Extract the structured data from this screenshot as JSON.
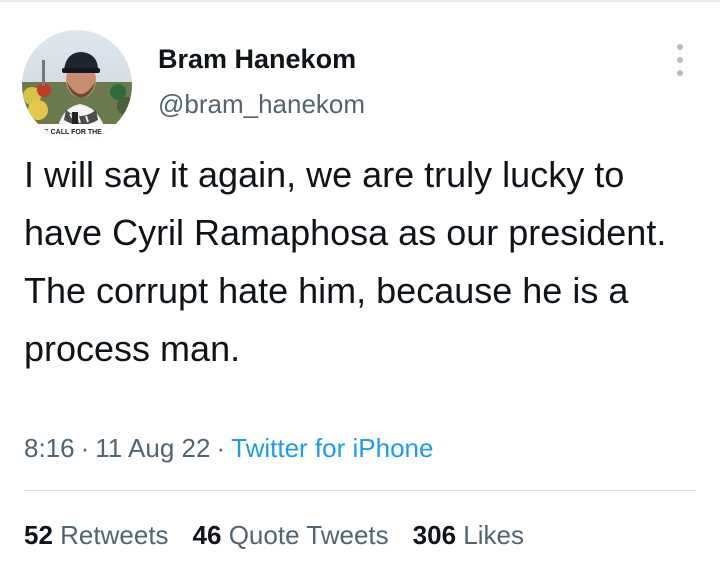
{
  "user": {
    "display_name": "Bram Hanekom",
    "handle": "@bram_hanekom",
    "avatar_caption": "S CALL FOR THE"
  },
  "tweet": {
    "text": "I will say it again, we are truly lucky to have Cyril Ramaphosa as our president. The corrupt hate him, because he is a process man."
  },
  "meta": {
    "time": "8:16",
    "separator": "·",
    "date": "11 Aug 22",
    "source": "Twitter for iPhone"
  },
  "stats": {
    "retweets_count": "52",
    "retweets_label": "Retweets",
    "quotes_count": "46",
    "quotes_label": "Quote Tweets",
    "likes_count": "306",
    "likes_label": "Likes"
  },
  "icons": {
    "more": "more-vertical-icon"
  },
  "colors": {
    "text": "#0f1419",
    "secondary": "#536471",
    "link": "#1d9bf0",
    "divider": "#dbe2e7"
  }
}
